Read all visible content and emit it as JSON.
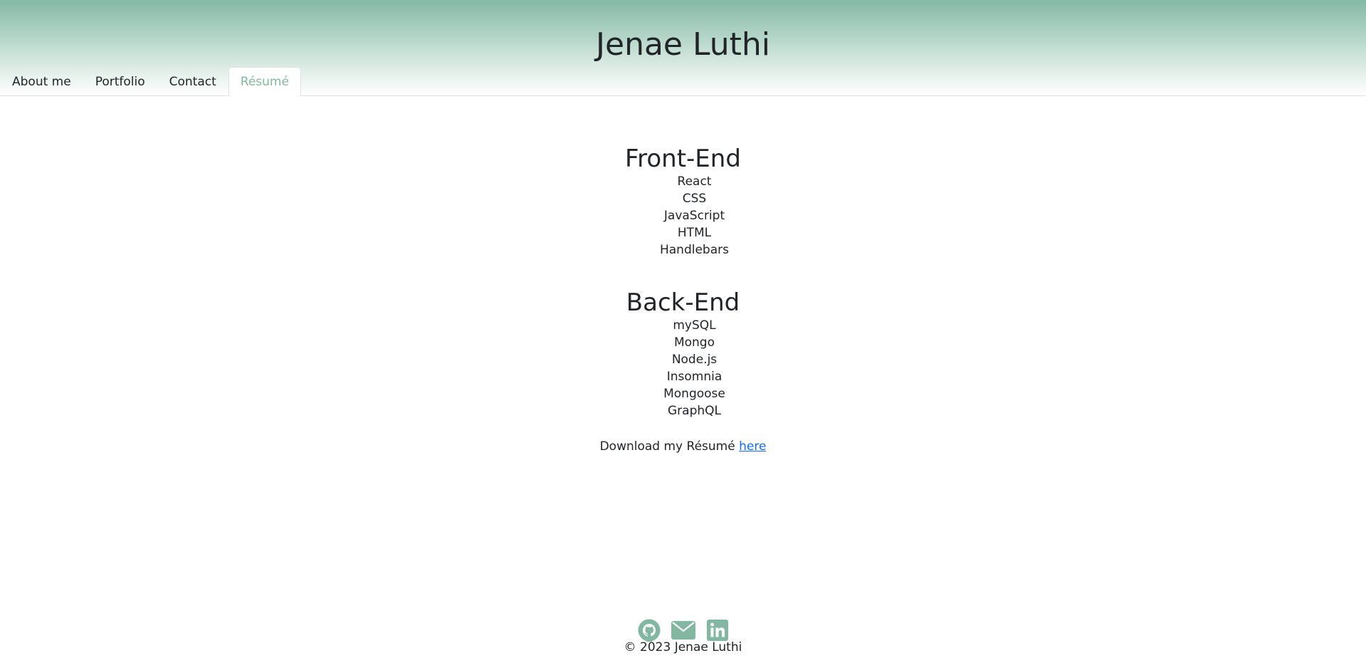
{
  "header": {
    "title": "Jenae Luthi"
  },
  "nav": {
    "tabs": [
      {
        "label": "About me",
        "active": false
      },
      {
        "label": "Portfolio",
        "active": false
      },
      {
        "label": "Contact",
        "active": false
      },
      {
        "label": "Résumé",
        "active": true
      }
    ]
  },
  "resume": {
    "front_end": {
      "heading": "Front-End",
      "items": [
        "React",
        "CSS",
        "JavaScript",
        "HTML",
        "Handlebars"
      ]
    },
    "back_end": {
      "heading": "Back-End",
      "items": [
        "mySQL",
        "Mongo",
        "Node.js",
        "Insomnia",
        "Mongoose",
        "GraphQL"
      ]
    },
    "download": {
      "text": "Download my Résumé",
      "link_label": "here"
    }
  },
  "footer": {
    "icons": [
      "github-icon",
      "email-icon",
      "linkedin-icon"
    ],
    "copyright": "© 2023 Jenae Luthi"
  },
  "colors": {
    "accent": "#7fbaa0",
    "link": "#0d6efd",
    "icon": "#82b8a2"
  }
}
